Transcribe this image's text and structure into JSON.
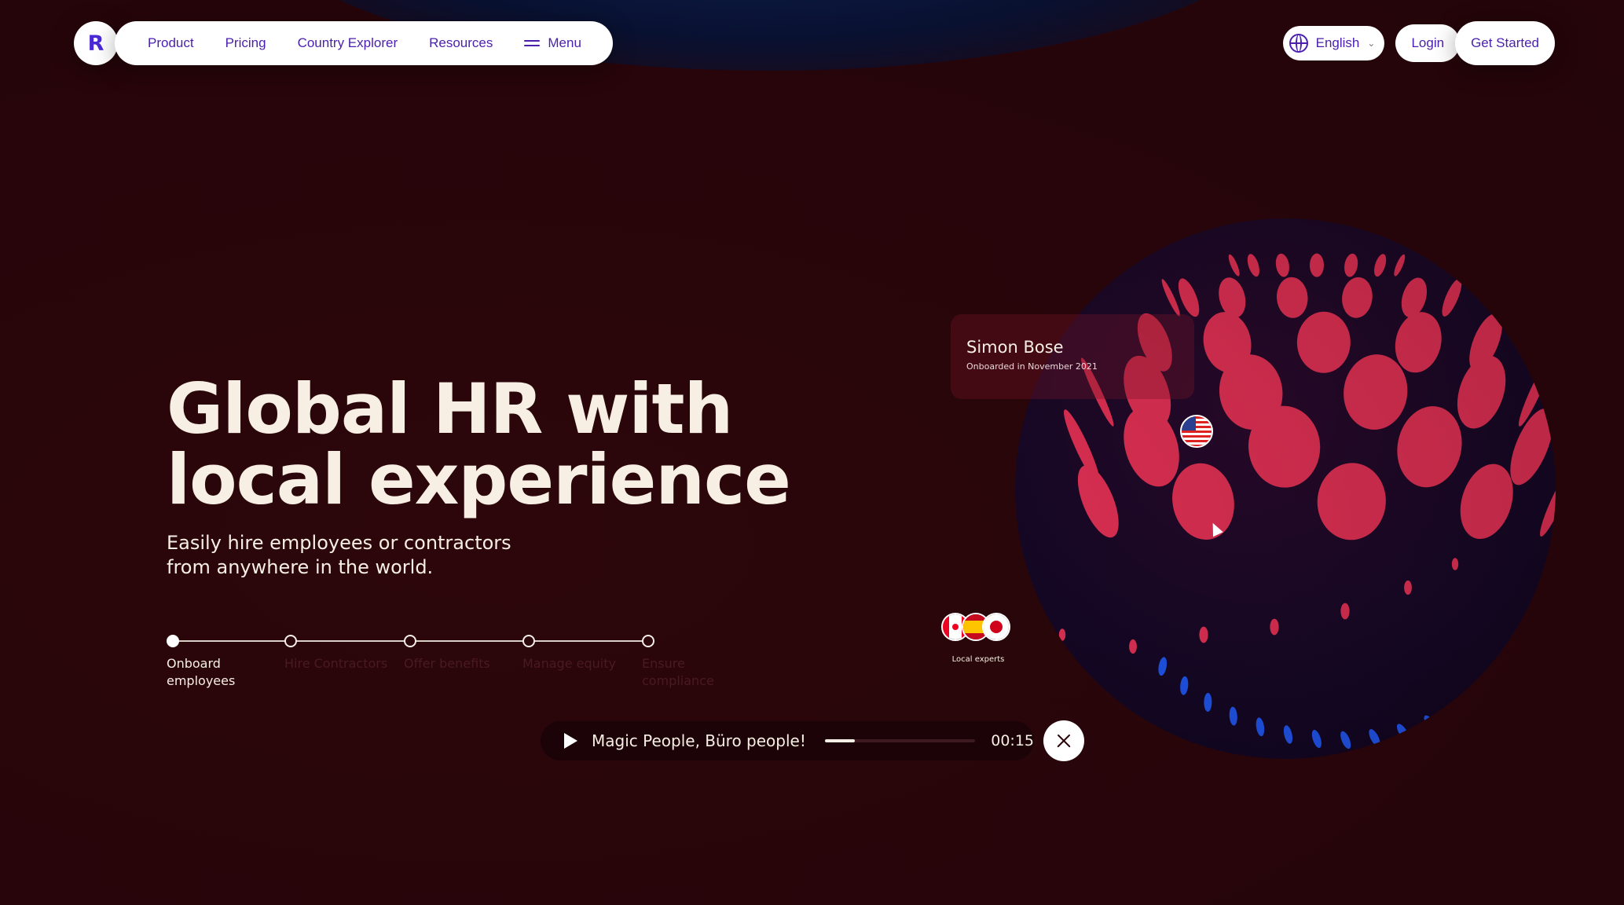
{
  "nav": {
    "logo": "R",
    "items": [
      {
        "label": "Product"
      },
      {
        "label": "Pricing"
      },
      {
        "label": "Country Explorer"
      },
      {
        "label": "Resources"
      },
      {
        "label": "Menu"
      }
    ],
    "language": "English",
    "login": "Login",
    "get_started": "Get Started"
  },
  "hero": {
    "title_line1": "Global HR with",
    "title_line2": "local experience",
    "subtitle_line1": "Easily hire employees or contractors",
    "subtitle_line2": "from anywhere in the world."
  },
  "steps": [
    {
      "label": "Onboard employees",
      "active": true
    },
    {
      "label": "Hire Contractors",
      "active": false
    },
    {
      "label": "Offer benefits",
      "active": false
    },
    {
      "label": "Manage equity",
      "active": false
    },
    {
      "label": "Ensure compliance",
      "active": false
    }
  ],
  "testimonial": {
    "name": "Simon Bose",
    "onboarded": "Onboarded in November 2021"
  },
  "local_experts": {
    "label": "Local experts"
  },
  "player": {
    "track": "Magic People, Büro people!",
    "time": "00:15",
    "progress": 0.2
  },
  "colors": {
    "background": "#2c060b",
    "accent": "#4a1fae",
    "sphere_petal": "#f0345a",
    "sphere_blue": "#1f5cff"
  }
}
